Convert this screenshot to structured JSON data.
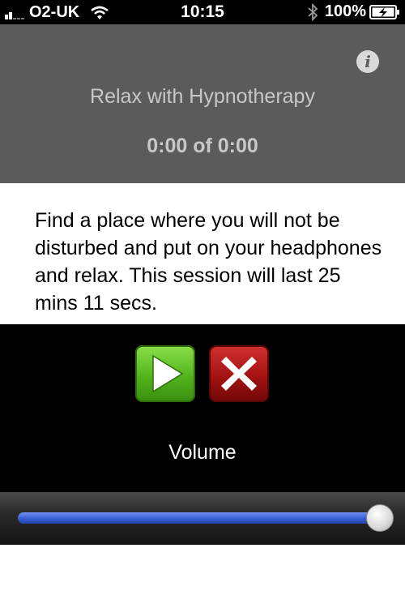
{
  "status_bar": {
    "carrier": "O2-UK",
    "time": "10:15",
    "battery_percent": "100%",
    "signal_bars": 2,
    "icons": [
      "signal-icon",
      "wifi-icon",
      "bluetooth-icon",
      "battery-charging-icon"
    ]
  },
  "header": {
    "info_icon": "i",
    "title": "Relax with Hypnotherapy",
    "time_display": "0:00 of 0:00"
  },
  "instructions": {
    "text": "Find a place where you will not be disturbed and put on your headphones and relax. This session will last 25 mins 11 secs."
  },
  "controls": {
    "play_icon": "play-icon",
    "stop_icon": "close-icon",
    "volume_label": "Volume",
    "volume_level": 0.99
  },
  "colors": {
    "header_bg": "#5b5b5b",
    "header_text": "#c8c8c8",
    "play_green": "#52b41c",
    "stop_red": "#a41212",
    "slider_blue": "#3a5fd4"
  }
}
